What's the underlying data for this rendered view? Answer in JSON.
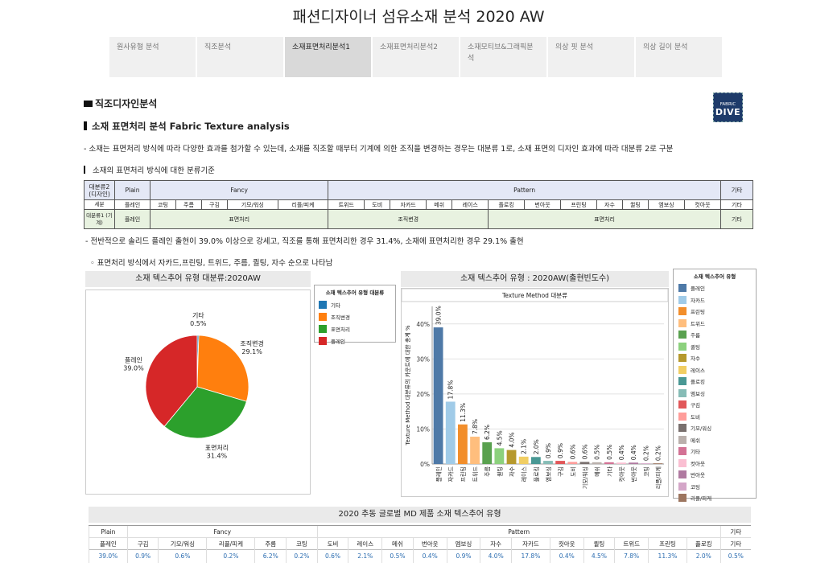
{
  "page_title": "패션디자이너 섬유소재 분석 2020 AW",
  "tabs": [
    "원사유형 분석",
    "직조분석",
    "소재표면처리분석1",
    "소재표면처리분석2",
    "소재모티브&그래픽분석",
    "의상 핏 분석",
    "의상 길이 분석"
  ],
  "active_tab": 2,
  "section_title": "직조디자인분석",
  "sub_title": "소재 표면처리 분석 Fabric Texture analysis",
  "logo": {
    "line1": "FABRIC",
    "line2": "DIVE"
  },
  "description": "- 소재는 표면처리 방식에 따라 다양한 효과를 첨가할 수 있는데, 소재를 직조할 때부터 기계에 의한 조직을 변경하는 경우는 대분류 1로, 소재 표면의 디자인 효과에 따라 대분류 2로 구분",
  "criteria_title": "소재의 표면처리 방식에 대한 분류기준",
  "classification": {
    "row1_label": "대분류2 (디자인)",
    "row2_label": "세분",
    "row3_label": "대분류1 (기계)",
    "groups": [
      "Plain",
      "Fancy",
      "Pattern",
      "기타"
    ],
    "sub": [
      "플레인",
      "코팅",
      "주름",
      "구김",
      "기모/워싱",
      "리플/피케",
      "트위드",
      "도비",
      "자카드",
      "메쉬",
      "레이스",
      "플로킹",
      "번아웃",
      "프린팅",
      "자수",
      "퀼팅",
      "엠보싱",
      "컷아웃",
      "기타"
    ],
    "mech": [
      "플레인",
      "표면처리",
      "조직변경",
      "표면처리",
      "기타"
    ]
  },
  "note1": "- 전반적으로 솔리드 플레인 출현이 39.0% 이상으로 강세고, 직조를 통해 표면처리한 경우 31.4%, 소재에 표면처리한 경우 29.1% 출현",
  "note2": "◦ 표면처리 방식에서 자카드,프린팅, 트위드, 주름, 퀼팅, 자수 순으로 나타남",
  "pie_header": "소재 텍스추어 유형 대분류:2020AW",
  "bar_header": "소재 텍스추어 유형 : 2020AW(출현빈도수)",
  "bottom_header": "2020 추동 글로벌 MD 제품 소재 텍스추어 유형",
  "chart_data": [
    {
      "type": "pie",
      "legend_title": "소재 텍스추어 유형 대분류",
      "legend": [
        "기타",
        "조직변경",
        "표면처리",
        "플레인"
      ],
      "slices": [
        {
          "label": "기타",
          "value": 0.5,
          "color": "#1f77b4"
        },
        {
          "label": "조직변경",
          "value": 29.1,
          "color": "#ff7f0e"
        },
        {
          "label": "표면처리",
          "value": 31.4,
          "color": "#2ca02c"
        },
        {
          "label": "플레인",
          "value": 39.0,
          "color": "#d62728"
        }
      ]
    },
    {
      "type": "bar",
      "title": "Texture Method 대분류",
      "ylabel": "Texture Method 대분류의 카운트에 대한 총계 %",
      "ylim": [
        0,
        45
      ],
      "yticks": [
        "0%",
        "10%",
        "20%",
        "30%",
        "40%"
      ],
      "grid": true,
      "legend_title": "소재 텍스추어 유형",
      "categories": [
        "플레인",
        "자카드",
        "프린팅",
        "트위드",
        "주름",
        "퀼팅",
        "자수",
        "레이스",
        "플로킹",
        "엠보싱",
        "구김",
        "도비",
        "기모/워싱",
        "메쉬",
        "기타",
        "컷아웃",
        "번아웃",
        "코팅",
        "리플/피케"
      ],
      "values": [
        39.0,
        17.8,
        11.3,
        7.8,
        6.2,
        4.5,
        4.0,
        2.1,
        2.0,
        0.9,
        0.9,
        0.6,
        0.6,
        0.5,
        0.5,
        0.4,
        0.4,
        0.2,
        0.2
      ],
      "labels": [
        "39.0%",
        "17.8%",
        "11.3%",
        "7.8%",
        "6.2%",
        "4.5%",
        "4.0%",
        "2.1%",
        "2.0%",
        "0.9%",
        "0.9%",
        "0.6%",
        "0.6%",
        "0.5%",
        "0.5%",
        "0.4%",
        "0.4%",
        "0.2%",
        "0.2%"
      ],
      "colors": [
        "#4e79a7",
        "#a0cbe8",
        "#f28e2b",
        "#ffbe7d",
        "#59a14f",
        "#8cd17d",
        "#b6992d",
        "#f1ce63",
        "#499894",
        "#86bcb6",
        "#e15759",
        "#ff9d9a",
        "#79706e",
        "#bab0ac",
        "#d37295",
        "#fabfd2",
        "#b07aa1",
        "#d4a6c8",
        "#9d7660"
      ]
    },
    {
      "type": "table",
      "group_row": [
        "Plain",
        "Fancy",
        "Pattern",
        "기타"
      ],
      "columns": [
        "플레인",
        "구김",
        "기모/워싱",
        "리플/피케",
        "주름",
        "코팅",
        "도비",
        "레이스",
        "메쉬",
        "번아웃",
        "엠보싱",
        "자수",
        "자카드",
        "컷아웃",
        "퀼팅",
        "트위드",
        "프린팅",
        "플로킹",
        "기타"
      ],
      "values": [
        "39.0%",
        "0.9%",
        "0.6%",
        "0.2%",
        "6.2%",
        "0.2%",
        "0.6%",
        "2.1%",
        "0.5%",
        "0.4%",
        "0.9%",
        "4.0%",
        "17.8%",
        "0.4%",
        "4.5%",
        "7.8%",
        "11.3%",
        "2.0%",
        "0.5%"
      ]
    }
  ]
}
